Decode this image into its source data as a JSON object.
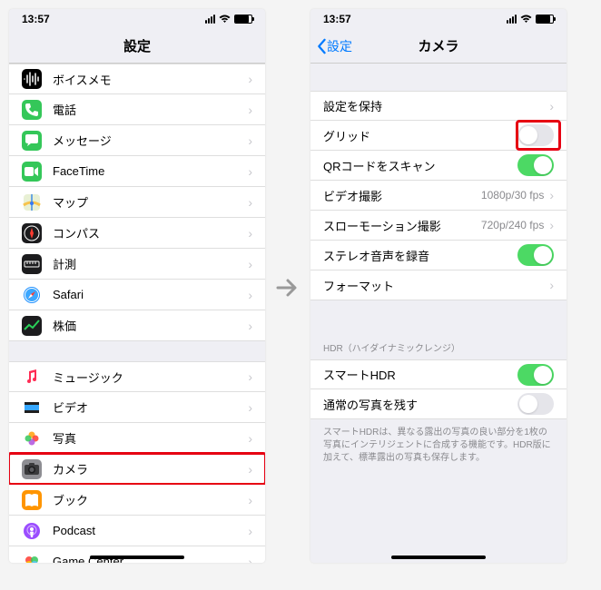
{
  "status": {
    "time": "13:57"
  },
  "left": {
    "title": "設定",
    "groups": [
      [
        {
          "icon": "voice-memo",
          "bg": "#000",
          "label": "ボイスメモ"
        },
        {
          "icon": "phone",
          "bg": "#34c759",
          "label": "電話"
        },
        {
          "icon": "messages",
          "bg": "#34c759",
          "label": "メッセージ"
        },
        {
          "icon": "facetime",
          "bg": "#34c759",
          "label": "FaceTime"
        },
        {
          "icon": "maps",
          "bg": "#fff",
          "label": "マップ"
        },
        {
          "icon": "compass",
          "bg": "#1c1c1e",
          "label": "コンパス"
        },
        {
          "icon": "measure",
          "bg": "#1c1c1e",
          "label": "計測"
        },
        {
          "icon": "safari",
          "bg": "#fff",
          "label": "Safari"
        },
        {
          "icon": "stocks",
          "bg": "#1c1c1e",
          "label": "株価"
        }
      ],
      [
        {
          "icon": "music",
          "bg": "#fff",
          "label": "ミュージック"
        },
        {
          "icon": "video",
          "bg": "#fff",
          "label": "ビデオ"
        },
        {
          "icon": "photos",
          "bg": "#fff",
          "label": "写真"
        },
        {
          "icon": "camera",
          "bg": "#8e8e93",
          "label": "カメラ",
          "highlighted": true
        },
        {
          "icon": "books",
          "bg": "#ff9500",
          "label": "ブック"
        },
        {
          "icon": "podcast",
          "bg": "#fff",
          "label": "Podcast"
        },
        {
          "icon": "gamecenter",
          "bg": "#fff",
          "label": "Game Center"
        }
      ]
    ]
  },
  "right": {
    "back": "設定",
    "title": "カメラ",
    "rows": [
      {
        "label": "設定を保持",
        "type": "chevron"
      },
      {
        "label": "グリッド",
        "type": "toggle",
        "on": false,
        "highlighted": true
      },
      {
        "label": "QRコードをスキャン",
        "type": "toggle",
        "on": true
      },
      {
        "label": "ビデオ撮影",
        "type": "value",
        "value": "1080p/30 fps"
      },
      {
        "label": "スローモーション撮影",
        "type": "value",
        "value": "720p/240 fps"
      },
      {
        "label": "ステレオ音声を録音",
        "type": "toggle",
        "on": true
      },
      {
        "label": "フォーマット",
        "type": "chevron"
      }
    ],
    "hdr_header": "HDR（ハイダイナミックレンジ）",
    "hdr_rows": [
      {
        "label": "スマートHDR",
        "type": "toggle",
        "on": true
      },
      {
        "label": "通常の写真を残す",
        "type": "toggle",
        "on": false
      }
    ],
    "footer": "スマートHDRは、異なる露出の写真の良い部分を1枚の写真にインテリジェントに合成する機能です。HDR版に加えて、標準露出の写真も保存します。"
  }
}
